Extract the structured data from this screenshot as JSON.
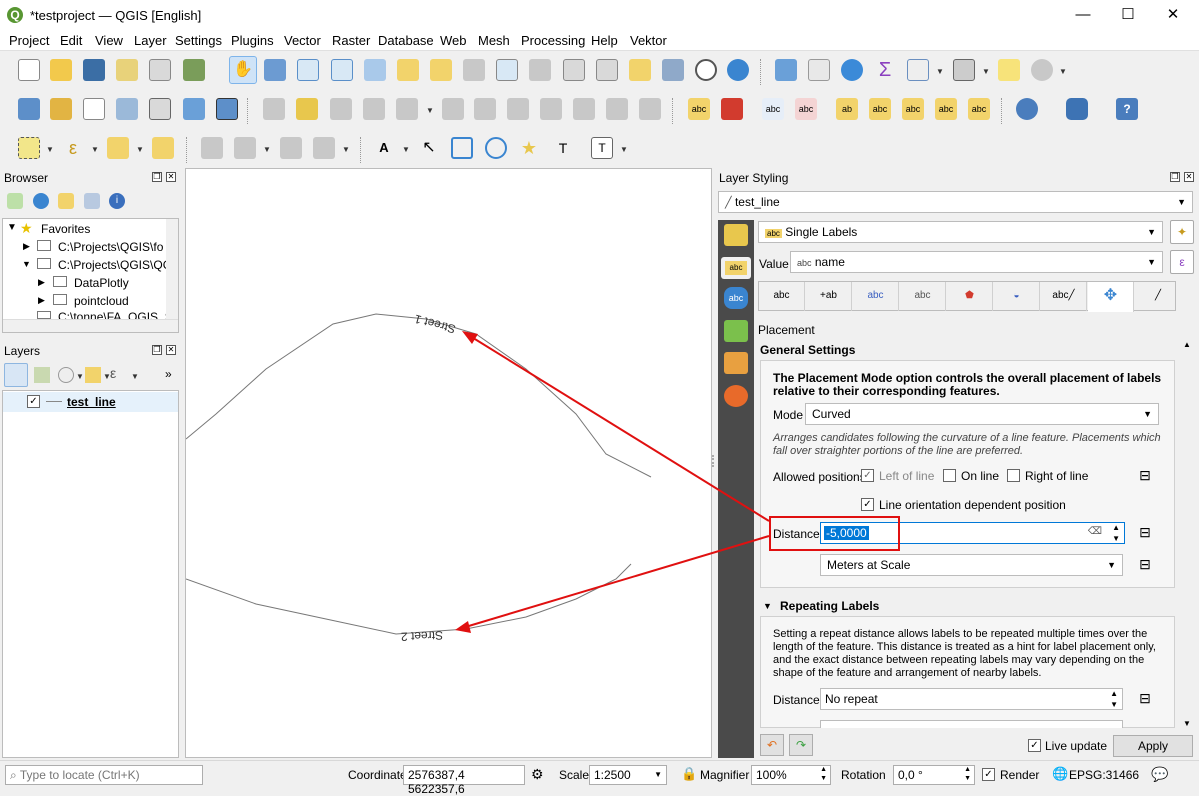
{
  "window": {
    "title": "*testproject — QGIS [English]",
    "minimize": "—",
    "maximize": "☐",
    "close": "✕"
  },
  "menu": [
    "Project",
    "Edit",
    "View",
    "Layer",
    "Settings",
    "Plugins",
    "Vector",
    "Raster",
    "Database",
    "Web",
    "Mesh",
    "Processing",
    "Help",
    "Vektor"
  ],
  "browser": {
    "title": "Browser",
    "favorites": "Favorites",
    "items": [
      "C:\\Projects\\QGIS\\fo",
      "C:\\Projects\\QGIS\\QG",
      "DataPlotly",
      "pointcloud",
      "C:\\tonne\\FA_QGIS_S"
    ]
  },
  "layers": {
    "title": "Layers",
    "layer_name": "test_line"
  },
  "map": {
    "label1": "Street 1",
    "label2": "Street 2"
  },
  "styling": {
    "title": "Layer Styling",
    "layer": "test_line",
    "renderer": "Single Labels",
    "value_label": "Value",
    "value": "name",
    "value_prefix": "abc",
    "section": "Placement",
    "general": "General Settings",
    "info": "The Placement Mode option controls the overall placement of labels relative to their corresponding features.",
    "mode_label": "Mode",
    "mode": "Curved",
    "mode_help": "Arranges candidates following the curvature of a line feature. Placements which fall over straighter portions of the line are preferred.",
    "allowed": "Allowed positions",
    "left": "Left of line",
    "on": "On line",
    "right": "Right of line",
    "orient": "Line orientation dependent position",
    "distance_label": "Distance",
    "distance": "-5,0000",
    "units": "Meters at Scale",
    "repeating": "Repeating Labels",
    "repeat_help": "Setting a repeat distance allows labels to be repeated multiple times over the length of the feature. This distance is treated as a hint for label placement only, and the exact distance between repeating labels may vary depending on the shape of the feature and arrangement of nearby labels.",
    "repeat_label": "Distance",
    "repeat": "No repeat",
    "live": "Live update",
    "apply": "Apply"
  },
  "status": {
    "locate": "Type to locate (Ctrl+K)",
    "coord_label": "Coordinate",
    "coord": "2576387,4 5622357,6",
    "scale_label": "Scale",
    "scale": "1:2500",
    "mag_label": "Magnifier",
    "mag": "100%",
    "rot_label": "Rotation",
    "rot": "0,0 °",
    "render": "Render",
    "crs": "EPSG:31466"
  },
  "colors": {
    "accent": "#589632",
    "highlight": "#0078d7",
    "arrow": "#e01010"
  }
}
